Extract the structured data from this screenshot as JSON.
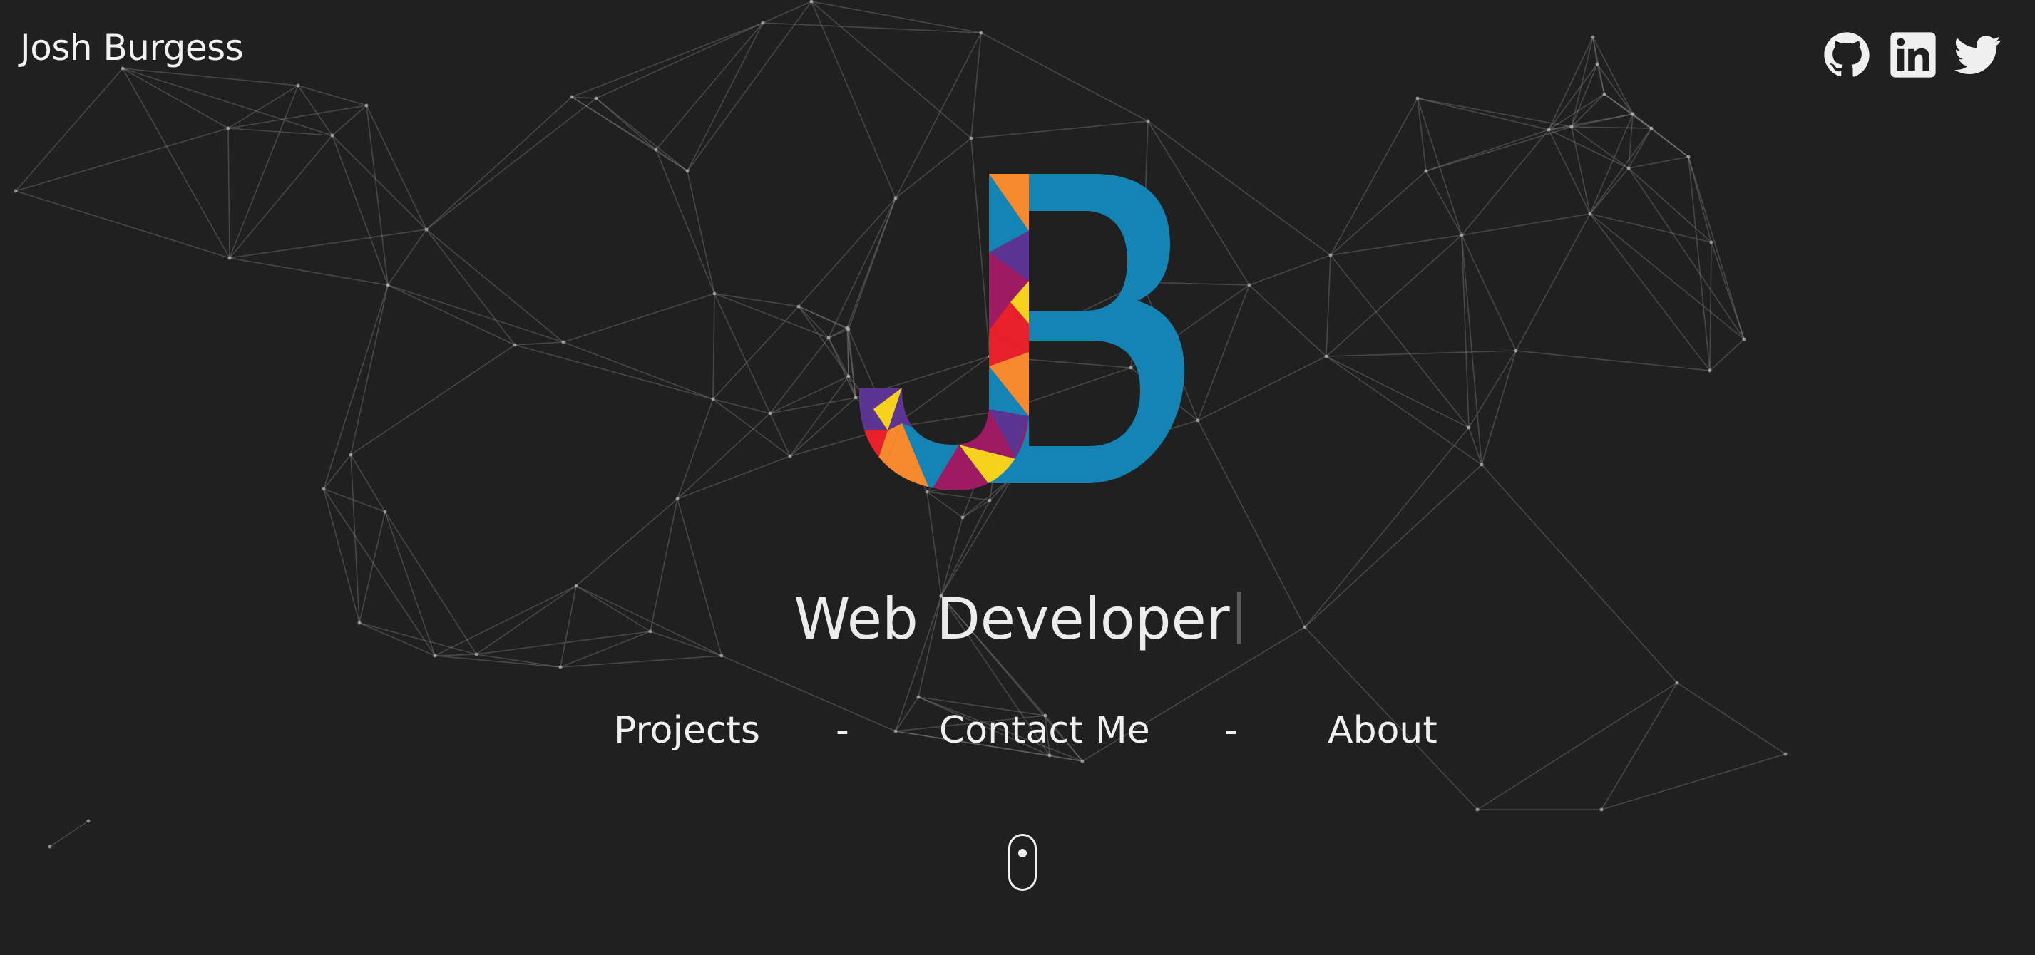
{
  "header": {
    "brand": "Josh Burgess",
    "social": [
      {
        "name": "github",
        "icon": "github-icon"
      },
      {
        "name": "linkedin",
        "icon": "linkedin-icon"
      },
      {
        "name": "twitter",
        "icon": "twitter-icon"
      }
    ]
  },
  "hero": {
    "logo": "JB",
    "headline": "Web Developer"
  },
  "nav": {
    "projects": "Projects",
    "separator_1": "-",
    "contact": "Contact Me",
    "separator_2": "-",
    "about": "About"
  },
  "scroll_indicator": {
    "icon": "mouse-scroll-icon"
  },
  "colors": {
    "background": "#202020",
    "text": "#f0f0f0",
    "accent_blue": "#1384b4",
    "purple": "#5b3591",
    "orange": "#f5892b",
    "red": "#e8202a",
    "yellow": "#f7d21c",
    "magenta": "#9e1a63"
  }
}
